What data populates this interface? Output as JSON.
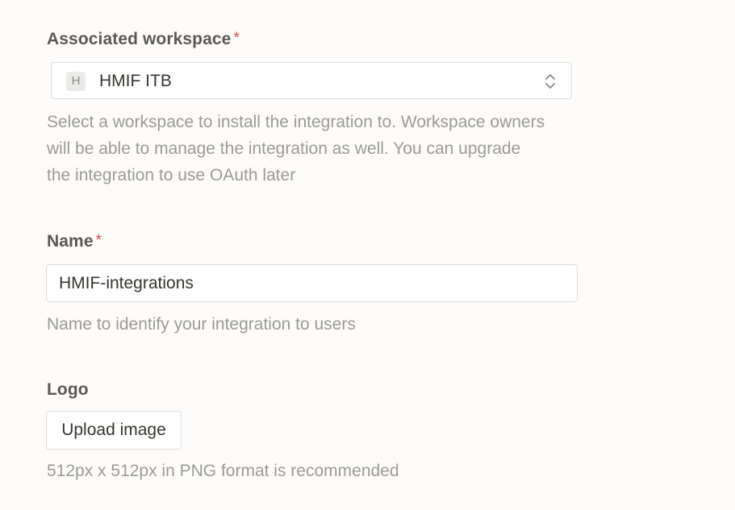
{
  "workspace": {
    "label": "Associated workspace",
    "required_mark": "*",
    "avatar_letter": "H",
    "selected_value": "HMIF ITB",
    "help_lines": [
      "Select a workspace to install the integration to. Workspace owners",
      "will be able to manage the integration as well. You can upgrade",
      "the integration to use OAuth later"
    ]
  },
  "name": {
    "label": "Name",
    "required_mark": "*",
    "value": "HMIF-integrations",
    "help": "Name to identify your integration to users"
  },
  "logo": {
    "label": "Logo",
    "upload_label": "Upload image",
    "help": "512px x 512px in PNG format is recommended"
  },
  "colors": {
    "required": "#e5484d",
    "help_text": "#9b9a97",
    "border": "#dfdedb",
    "background": "#fdfcfb"
  },
  "icons": {
    "workspace_select_toggle": "chevron-up-down-icon"
  }
}
